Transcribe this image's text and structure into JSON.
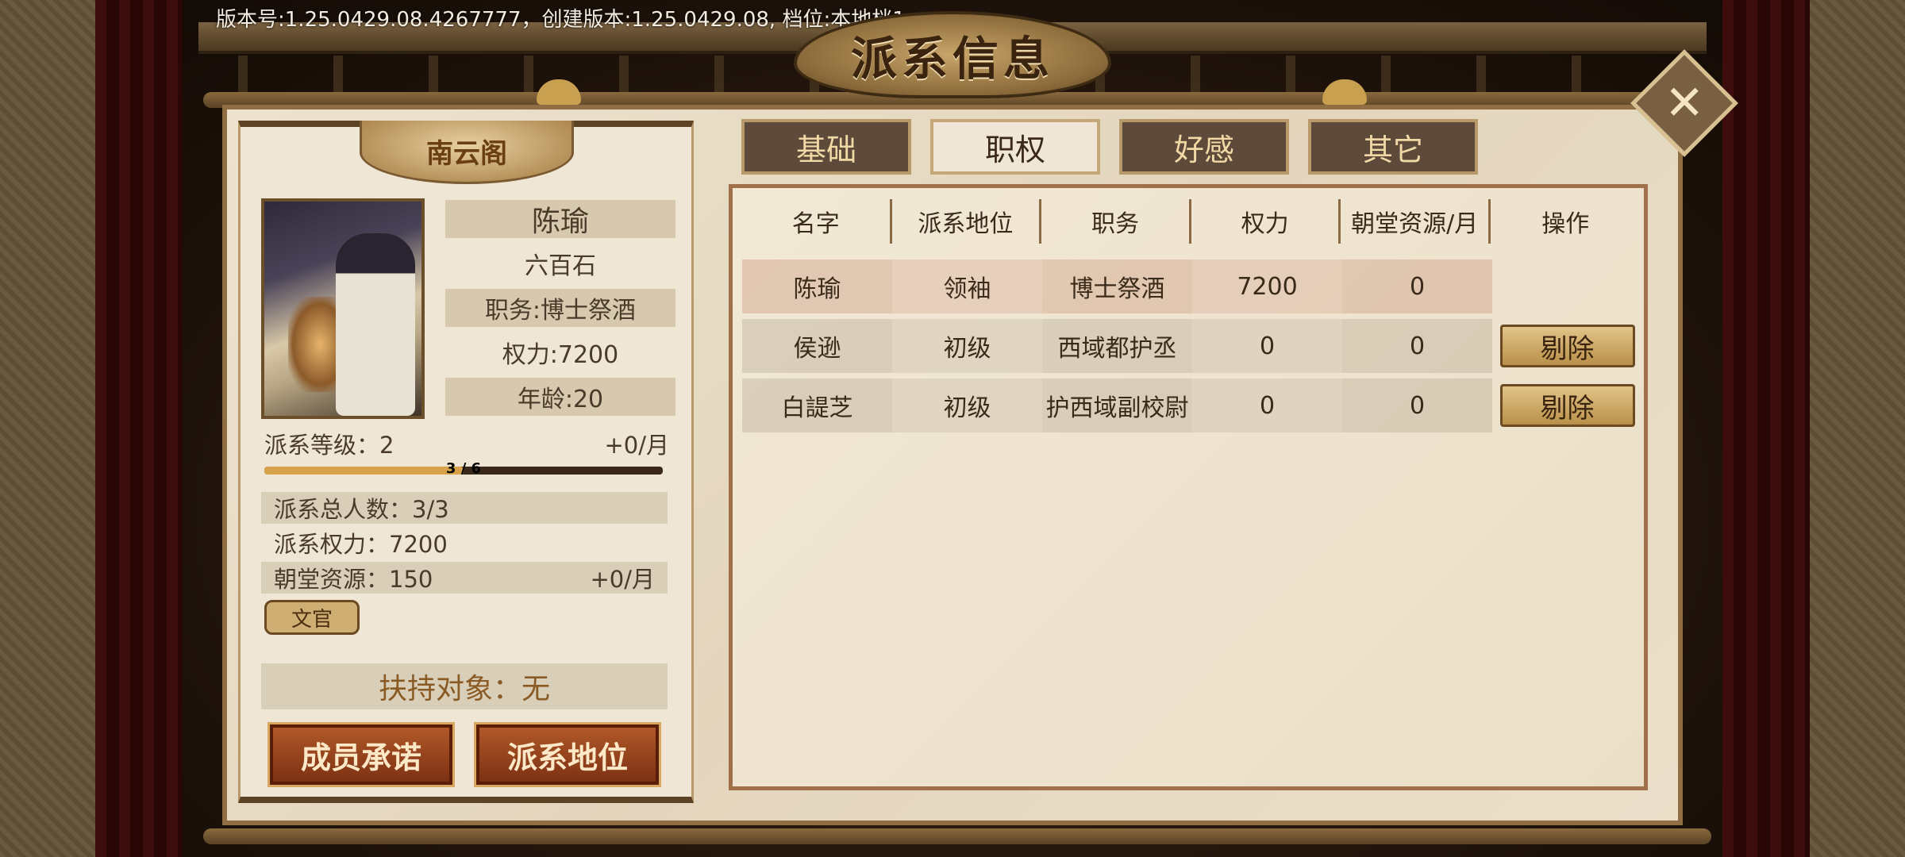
{
  "header": {
    "version_text": "版本号:1.25.0429.08.4267777，创建版本:1.25.0429.08, 档位:本地档1",
    "title": "派系信息",
    "close_icon": "close-icon"
  },
  "left": {
    "sect_name": "南云阁",
    "character": {
      "name": "陈瑜",
      "rank": "六百石",
      "position": "职务:博士祭酒",
      "power": "权力:7200",
      "age": "年龄:20"
    },
    "faction_level_label": "派系等级：2",
    "faction_level_rate": "+0/月",
    "progress_text": "3 / 6",
    "progress_fraction": 0.5,
    "stats": {
      "members": "派系总人数：3/3",
      "power": "派系权力：7200",
      "resource": "朝堂资源：150",
      "resource_rate": "+0/月"
    },
    "tag": "文官",
    "support": "扶持对象：无",
    "buttons": {
      "promise": "成员承诺",
      "status": "派系地位"
    }
  },
  "tabs": [
    {
      "label": "基础",
      "active": false
    },
    {
      "label": "职权",
      "active": true
    },
    {
      "label": "好感",
      "active": false
    },
    {
      "label": "其它",
      "active": false
    }
  ],
  "table": {
    "headers": [
      "名字",
      "派系地位",
      "职务",
      "权力",
      "朝堂资源/月",
      "操作"
    ],
    "rows": [
      {
        "name": "陈瑜",
        "status": "领袖",
        "position": "博士祭酒",
        "power": "7200",
        "resource": "0",
        "action": ""
      },
      {
        "name": "侯逊",
        "status": "初级",
        "position": "西域都护丞",
        "power": "0",
        "resource": "0",
        "action": "剔除"
      },
      {
        "name": "白諟芝",
        "status": "初级",
        "position": "护西域副校尉",
        "power": "0",
        "resource": "0",
        "action": "剔除"
      }
    ]
  }
}
